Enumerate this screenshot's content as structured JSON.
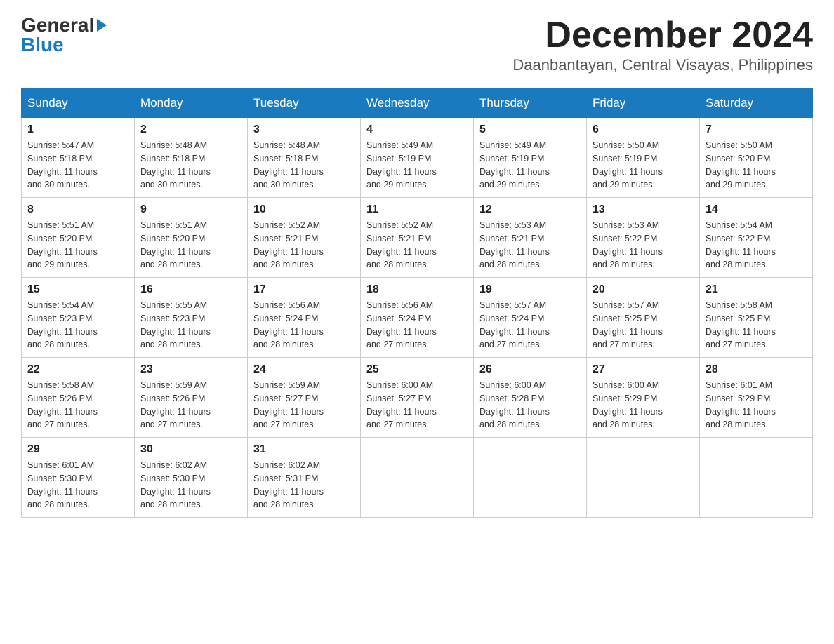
{
  "logo": {
    "general": "General",
    "blue": "Blue",
    "triangle": "▶"
  },
  "title": {
    "month_year": "December 2024",
    "location": "Daanbantayan, Central Visayas, Philippines"
  },
  "days_of_week": [
    "Sunday",
    "Monday",
    "Tuesday",
    "Wednesday",
    "Thursday",
    "Friday",
    "Saturday"
  ],
  "weeks": [
    [
      {
        "day": "1",
        "sunrise": "5:47 AM",
        "sunset": "5:18 PM",
        "daylight": "11 hours and 30 minutes."
      },
      {
        "day": "2",
        "sunrise": "5:48 AM",
        "sunset": "5:18 PM",
        "daylight": "11 hours and 30 minutes."
      },
      {
        "day": "3",
        "sunrise": "5:48 AM",
        "sunset": "5:18 PM",
        "daylight": "11 hours and 30 minutes."
      },
      {
        "day": "4",
        "sunrise": "5:49 AM",
        "sunset": "5:19 PM",
        "daylight": "11 hours and 29 minutes."
      },
      {
        "day": "5",
        "sunrise": "5:49 AM",
        "sunset": "5:19 PM",
        "daylight": "11 hours and 29 minutes."
      },
      {
        "day": "6",
        "sunrise": "5:50 AM",
        "sunset": "5:19 PM",
        "daylight": "11 hours and 29 minutes."
      },
      {
        "day": "7",
        "sunrise": "5:50 AM",
        "sunset": "5:20 PM",
        "daylight": "11 hours and 29 minutes."
      }
    ],
    [
      {
        "day": "8",
        "sunrise": "5:51 AM",
        "sunset": "5:20 PM",
        "daylight": "11 hours and 29 minutes."
      },
      {
        "day": "9",
        "sunrise": "5:51 AM",
        "sunset": "5:20 PM",
        "daylight": "11 hours and 28 minutes."
      },
      {
        "day": "10",
        "sunrise": "5:52 AM",
        "sunset": "5:21 PM",
        "daylight": "11 hours and 28 minutes."
      },
      {
        "day": "11",
        "sunrise": "5:52 AM",
        "sunset": "5:21 PM",
        "daylight": "11 hours and 28 minutes."
      },
      {
        "day": "12",
        "sunrise": "5:53 AM",
        "sunset": "5:21 PM",
        "daylight": "11 hours and 28 minutes."
      },
      {
        "day": "13",
        "sunrise": "5:53 AM",
        "sunset": "5:22 PM",
        "daylight": "11 hours and 28 minutes."
      },
      {
        "day": "14",
        "sunrise": "5:54 AM",
        "sunset": "5:22 PM",
        "daylight": "11 hours and 28 minutes."
      }
    ],
    [
      {
        "day": "15",
        "sunrise": "5:54 AM",
        "sunset": "5:23 PM",
        "daylight": "11 hours and 28 minutes."
      },
      {
        "day": "16",
        "sunrise": "5:55 AM",
        "sunset": "5:23 PM",
        "daylight": "11 hours and 28 minutes."
      },
      {
        "day": "17",
        "sunrise": "5:56 AM",
        "sunset": "5:24 PM",
        "daylight": "11 hours and 28 minutes."
      },
      {
        "day": "18",
        "sunrise": "5:56 AM",
        "sunset": "5:24 PM",
        "daylight": "11 hours and 27 minutes."
      },
      {
        "day": "19",
        "sunrise": "5:57 AM",
        "sunset": "5:24 PM",
        "daylight": "11 hours and 27 minutes."
      },
      {
        "day": "20",
        "sunrise": "5:57 AM",
        "sunset": "5:25 PM",
        "daylight": "11 hours and 27 minutes."
      },
      {
        "day": "21",
        "sunrise": "5:58 AM",
        "sunset": "5:25 PM",
        "daylight": "11 hours and 27 minutes."
      }
    ],
    [
      {
        "day": "22",
        "sunrise": "5:58 AM",
        "sunset": "5:26 PM",
        "daylight": "11 hours and 27 minutes."
      },
      {
        "day": "23",
        "sunrise": "5:59 AM",
        "sunset": "5:26 PM",
        "daylight": "11 hours and 27 minutes."
      },
      {
        "day": "24",
        "sunrise": "5:59 AM",
        "sunset": "5:27 PM",
        "daylight": "11 hours and 27 minutes."
      },
      {
        "day": "25",
        "sunrise": "6:00 AM",
        "sunset": "5:27 PM",
        "daylight": "11 hours and 27 minutes."
      },
      {
        "day": "26",
        "sunrise": "6:00 AM",
        "sunset": "5:28 PM",
        "daylight": "11 hours and 28 minutes."
      },
      {
        "day": "27",
        "sunrise": "6:00 AM",
        "sunset": "5:29 PM",
        "daylight": "11 hours and 28 minutes."
      },
      {
        "day": "28",
        "sunrise": "6:01 AM",
        "sunset": "5:29 PM",
        "daylight": "11 hours and 28 minutes."
      }
    ],
    [
      {
        "day": "29",
        "sunrise": "6:01 AM",
        "sunset": "5:30 PM",
        "daylight": "11 hours and 28 minutes."
      },
      {
        "day": "30",
        "sunrise": "6:02 AM",
        "sunset": "5:30 PM",
        "daylight": "11 hours and 28 minutes."
      },
      {
        "day": "31",
        "sunrise": "6:02 AM",
        "sunset": "5:31 PM",
        "daylight": "11 hours and 28 minutes."
      },
      null,
      null,
      null,
      null
    ]
  ],
  "labels": {
    "sunrise_prefix": "Sunrise: ",
    "sunset_prefix": "Sunset: ",
    "daylight_prefix": "Daylight: "
  }
}
